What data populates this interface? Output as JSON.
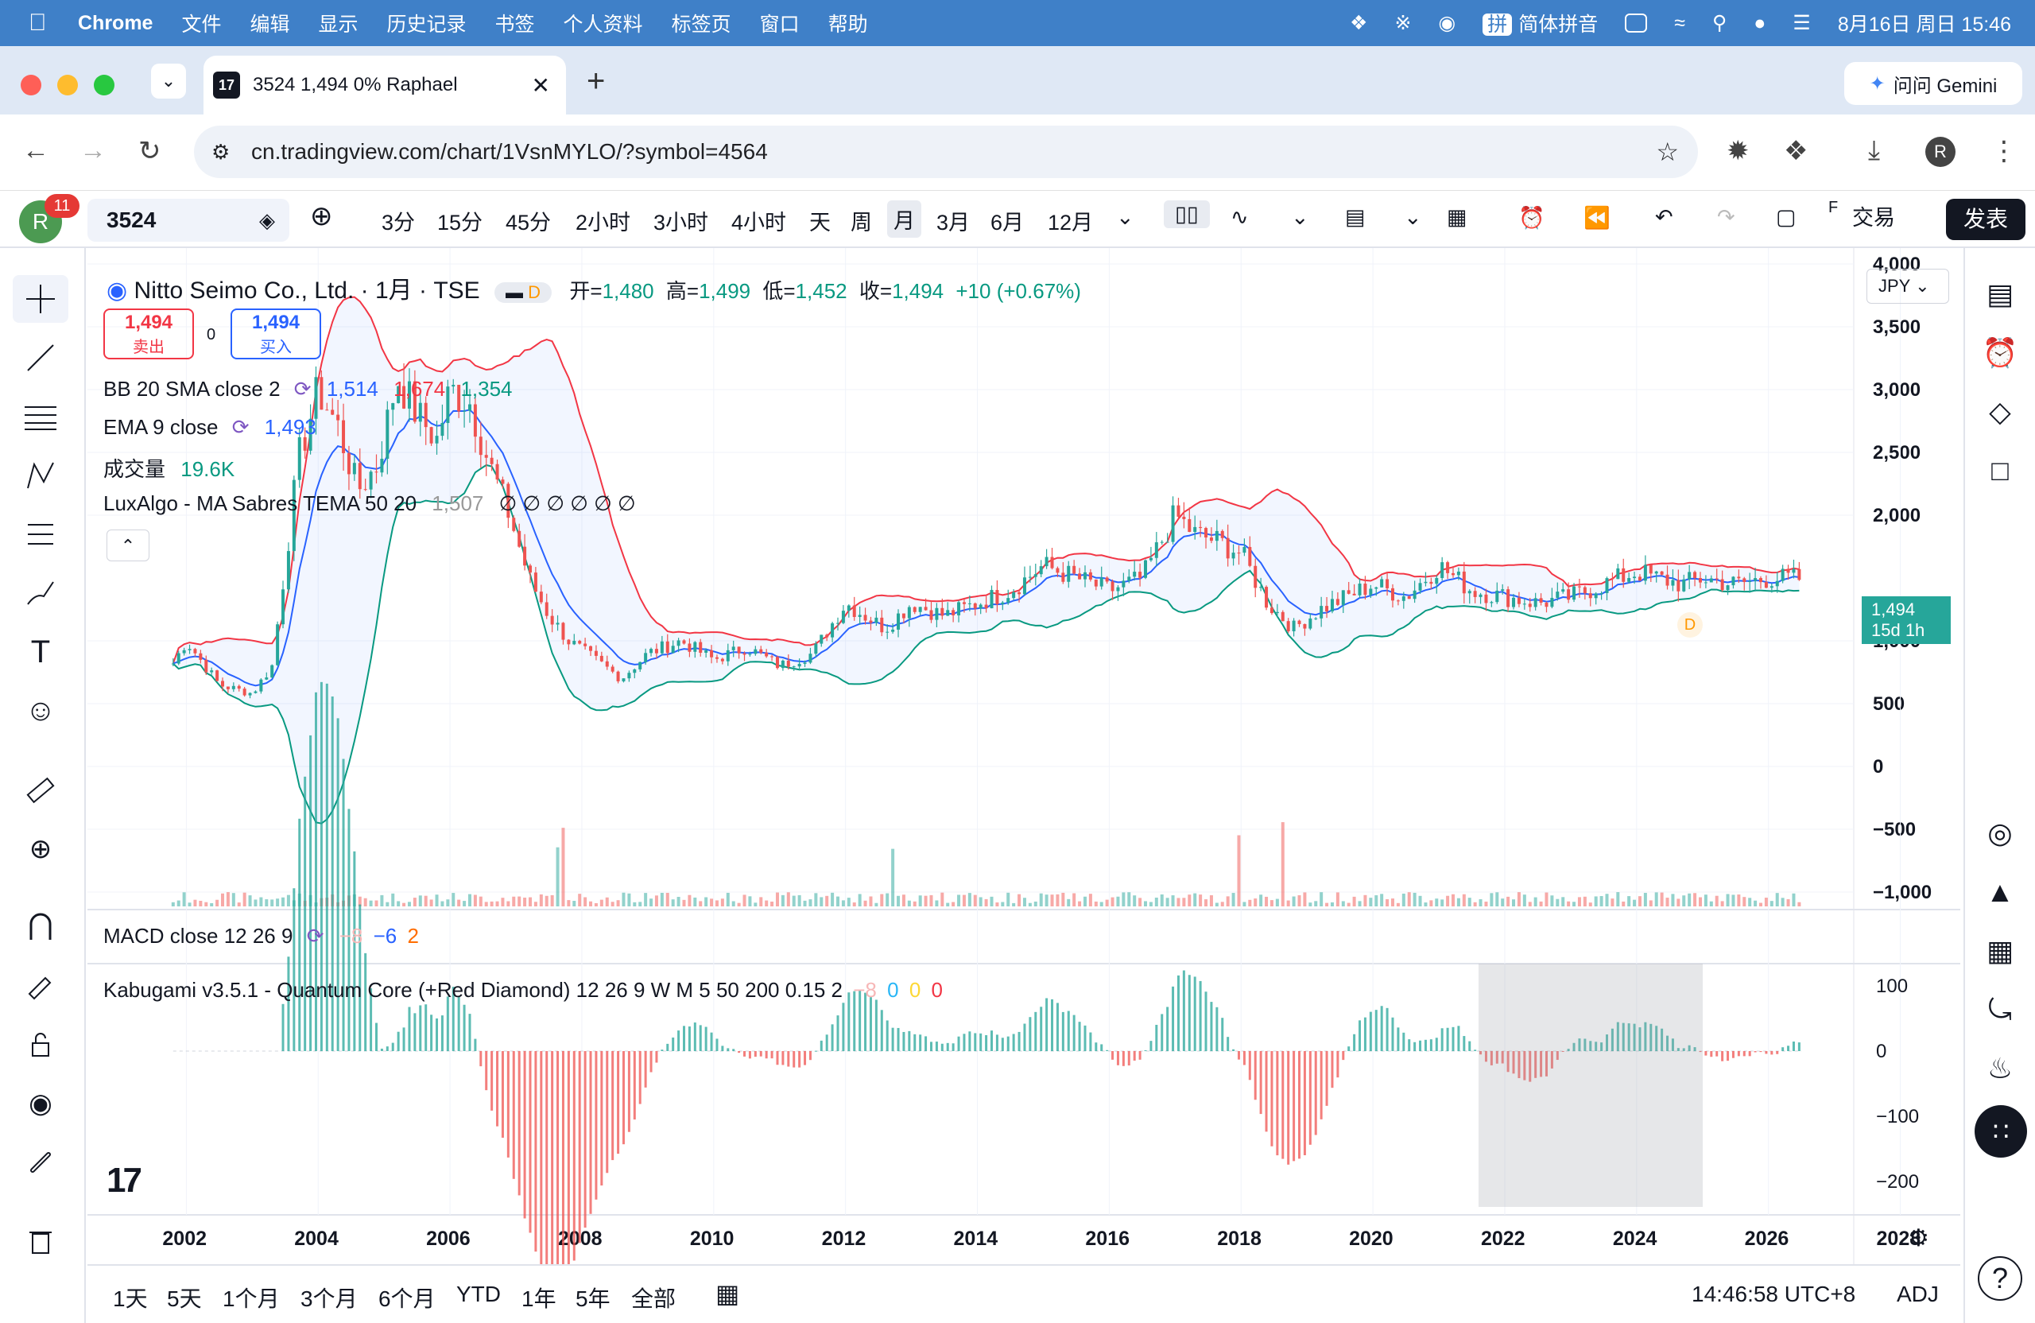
{
  "menubar": {
    "app": "Chrome",
    "items": [
      "文件",
      "编辑",
      "显示",
      "历史记录",
      "书签",
      "个人资料",
      "标签页",
      "窗口",
      "帮助"
    ],
    "input_method": "简体拼音",
    "datetime": "8月16日 周日 15:46"
  },
  "browser": {
    "tab_title": "3524 1,494 0% Raphael",
    "gemini_label": "问问 Gemini",
    "url": "cn.tradingview.com/chart/1VsnMYLO/?symbol=4564",
    "profile_initial": "R"
  },
  "tv_toolbar": {
    "avatar_initial": "R",
    "notification_count": "11",
    "symbol": "3524",
    "timeframes": [
      "3分",
      "15分",
      "45分",
      "2小时",
      "3小时",
      "4小时",
      "天",
      "周",
      "月",
      "3月",
      "6月",
      "12月"
    ],
    "active_timeframe": "月",
    "trade_label": "交易",
    "publish_label": "发表"
  },
  "legend": {
    "title": "Nitto Seimo Co., Ltd. · 1月 · TSE",
    "d_badge": "D",
    "ohlc": {
      "open_label": "开=",
      "open": "1,480",
      "high_label": "高=",
      "high": "1,499",
      "low_label": "低=",
      "low": "1,452",
      "close_label": "收=",
      "close": "1,494",
      "change": "+10 (+0.67%)"
    },
    "sell_price": "1,494",
    "sell_label": "卖出",
    "spread": "0",
    "buy_price": "1,494",
    "buy_label": "买入",
    "bb": {
      "name": "BB 20 SMA close 2",
      "basis": "1,514",
      "upper": "1,674",
      "lower": "1,354"
    },
    "ema": {
      "name": "EMA 9 close",
      "value": "1,493"
    },
    "volume": {
      "name": "成交量",
      "value": "19.6K"
    },
    "luxalgo": {
      "name": "LuxAlgo - MA Sabres TEMA 50 20",
      "value": "1,507",
      "nulls": "∅ ∅ ∅ ∅ ∅ ∅"
    }
  },
  "macd_pane": {
    "name": "MACD close 12 26 9",
    "v1": "−8",
    "v2": "−6",
    "v3": "2"
  },
  "kabu_pane": {
    "name": "Kabugami v3.5.1 - Quantum Core (+Red Diamond) 12 26 9 W M 5 50 200 0.15 2",
    "v1": "−8",
    "v2": "0",
    "v3": "0",
    "v4": "0"
  },
  "price_axis": {
    "currency": "JPY",
    "labels": [
      "4,000",
      "3,500",
      "3,000",
      "2,500",
      "2,000",
      "1,000",
      "500",
      "0",
      "−500",
      "−1,000"
    ],
    "current_price": "1,494",
    "countdown": "15d 1h",
    "d_marker": "D"
  },
  "osc_axis": {
    "labels": [
      "100",
      "0",
      "−100",
      "−200"
    ]
  },
  "time_axis": {
    "labels": [
      "2002",
      "2004",
      "2006",
      "2008",
      "2010",
      "2012",
      "2014",
      "2016",
      "2018",
      "2020",
      "2022",
      "2024",
      "2026",
      "2028"
    ]
  },
  "bottom_bar": {
    "ranges": [
      "1天",
      "5天",
      "1个月",
      "3个月",
      "6个月",
      "YTD",
      "1年",
      "5年",
      "全部"
    ],
    "clock": "14:46:58 UTC+8",
    "adj": "ADJ"
  },
  "colors": {
    "up": "#26a69a",
    "down": "#ef5350",
    "bb_upper": "#f23645",
    "bb_lower": "#089981",
    "basis": "#2962ff",
    "accent": "#2962ff"
  },
  "chart_data": {
    "type": "line",
    "series": [
      {
        "name": "Nitto Seimo Co., Ltd.",
        "x": [
          2001.8,
          2002.0,
          2002.5,
          2003.0,
          2003.3,
          2003.5,
          2003.7,
          2004.0,
          2004.3,
          2004.6,
          2004.9,
          2005.2,
          2005.5,
          2005.8,
          2006.0,
          2006.3,
          2006.6,
          2006.9,
          2007.2,
          2007.5,
          2007.8,
          2008.2,
          2008.6,
          2009.0,
          2009.5,
          2010.0,
          2010.5,
          2011.0,
          2011.5,
          2012.0,
          2012.3,
          2012.6,
          2013.0,
          2013.5,
          2014.0,
          2014.5,
          2015.0,
          2015.5,
          2016.0,
          2016.5,
          2017.0,
          2017.3,
          2017.6,
          2018.0,
          2018.4,
          2018.8,
          2019.2,
          2019.6,
          2020.0,
          2020.5,
          2021.0,
          2021.5,
          2022.0,
          2022.5,
          2023.0,
          2023.5,
          2024.0,
          2024.3,
          2024.7,
          2025.0,
          2025.5,
          2026.0,
          2026.5
        ],
        "values": [
          820,
          1000,
          650,
          580,
          800,
          1600,
          2450,
          3000,
          2700,
          2200,
          2400,
          3100,
          2800,
          2600,
          3000,
          2900,
          2400,
          2000,
          1500,
          1200,
          1000,
          850,
          700,
          900,
          1000,
          850,
          950,
          800,
          900,
          1300,
          1200,
          1100,
          1300,
          1200,
          1300,
          1400,
          1600,
          1500,
          1400,
          1500,
          2000,
          1850,
          1800,
          1700,
          1300,
          1100,
          1250,
          1350,
          1450,
          1350,
          1600,
          1400,
          1350,
          1300,
          1350,
          1450,
          1550,
          1500,
          1450,
          1500,
          1450,
          1500,
          1494
        ]
      }
    ],
    "ylim": [
      -1000,
      4000
    ],
    "xlim": [
      2000.5,
      2028.5
    ]
  }
}
